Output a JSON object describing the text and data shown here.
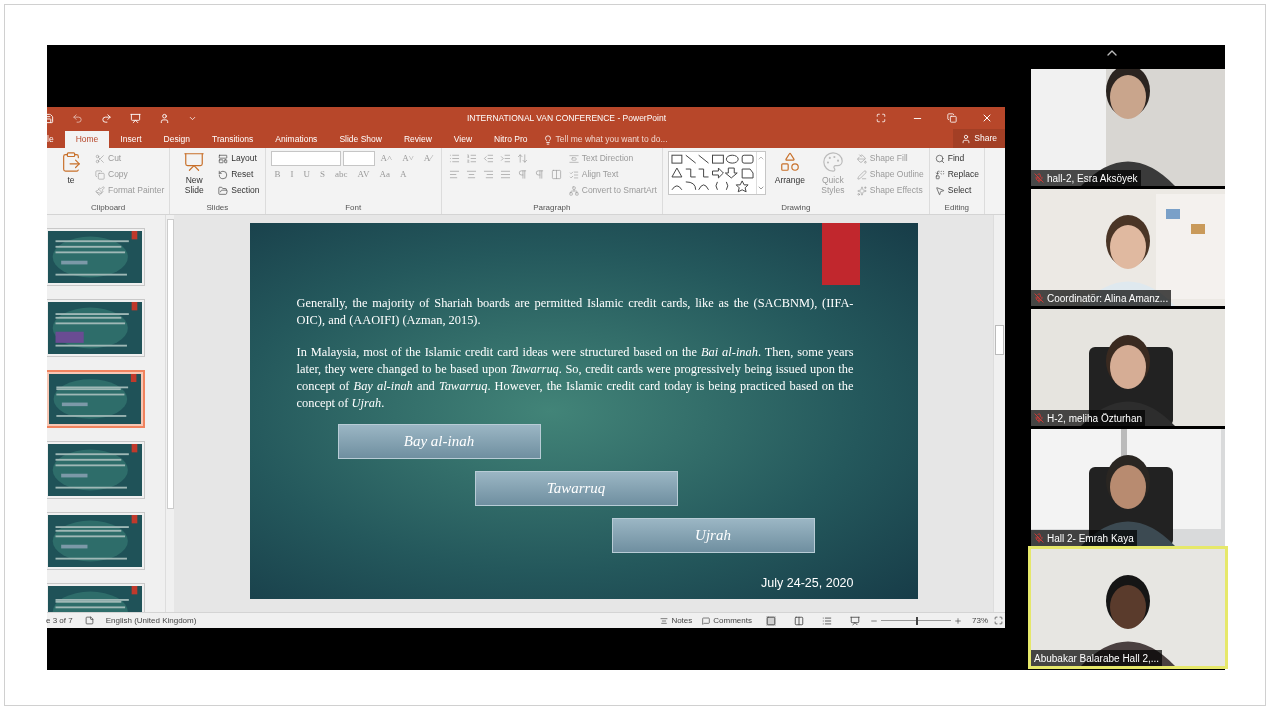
{
  "powerpoint": {
    "window": {
      "title": "INTERNATIONAL VAN CONFERENCE - PowerPoint"
    },
    "tabs": [
      {
        "label": "le",
        "selected": false
      },
      {
        "label": "Home",
        "selected": true
      },
      {
        "label": "Insert",
        "selected": false
      },
      {
        "label": "Design",
        "selected": false
      },
      {
        "label": "Transitions",
        "selected": false
      },
      {
        "label": "Animations",
        "selected": false
      },
      {
        "label": "Slide Show",
        "selected": false
      },
      {
        "label": "Review",
        "selected": false
      },
      {
        "label": "View",
        "selected": false
      },
      {
        "label": "Nitro Pro",
        "selected": false
      }
    ],
    "tell_me": {
      "placeholder": "Tell me what you want to do..."
    },
    "share_button": "Share",
    "ribbon_groups": [
      {
        "name": "Clipboard",
        "columns": [
          [
            [
              {
                "kind": "large",
                "label": "te"
              }
            ]
          ],
          [
            [
              {
                "kind": "small",
                "label": "Cut",
                "disabled": true
              }
            ],
            [
              {
                "kind": "small",
                "label": "Copy",
                "disabled": true
              }
            ],
            [
              {
                "kind": "small",
                "label": "Format Painter",
                "disabled": true
              }
            ]
          ]
        ]
      },
      {
        "name": "Slides",
        "columns": [
          [
            [
              {
                "kind": "large",
                "label": "New Slide"
              }
            ]
          ],
          [
            [
              {
                "kind": "small",
                "label": "Layout"
              }
            ],
            [
              {
                "kind": "small",
                "label": "Reset"
              }
            ],
            [
              {
                "kind": "small",
                "label": "Section"
              }
            ]
          ]
        ]
      },
      {
        "name": "Font",
        "columns": [
          [
            [
              {
                "kind": "combo"
              },
              {
                "kind": "combo-small"
              },
              {
                "kind": "glyph",
                "label": "A˄"
              },
              {
                "kind": "glyph",
                "label": "A˅"
              },
              {
                "kind": "glyph",
                "label": "A⁄"
              }
            ],
            [
              {
                "kind": "glyph",
                "label": "B"
              },
              {
                "kind": "glyph",
                "label": "I"
              },
              {
                "kind": "glyph",
                "label": "U"
              },
              {
                "kind": "glyph",
                "label": "S"
              },
              {
                "kind": "glyph",
                "label": "abc"
              },
              {
                "kind": "glyph",
                "label": "AV"
              },
              {
                "kind": "glyph",
                "label": "Aa"
              },
              {
                "kind": "glyph",
                "label": "A"
              }
            ]
          ]
        ]
      },
      {
        "name": "Paragraph",
        "columns": [
          [
            [
              {
                "kind": "icon"
              },
              {
                "kind": "icon"
              },
              {
                "kind": "icon"
              },
              {
                "kind": "icon"
              },
              {
                "kind": "icon"
              }
            ],
            [
              {
                "kind": "icon"
              },
              {
                "kind": "icon"
              },
              {
                "kind": "icon"
              },
              {
                "kind": "icon"
              },
              {
                "kind": "icon"
              },
              {
                "kind": "icon"
              },
              {
                "kind": "icon"
              }
            ]
          ],
          [
            [
              {
                "kind": "small",
                "label": "Text Direction",
                "disabled": true
              }
            ],
            [
              {
                "kind": "small",
                "label": "Align Text",
                "disabled": true
              }
            ],
            [
              {
                "kind": "small",
                "label": "Convert to SmartArt",
                "disabled": true
              }
            ]
          ]
        ]
      },
      {
        "name": "Drawing",
        "columns": [
          [
            [
              {
                "kind": "gallery"
              }
            ]
          ],
          [
            [
              {
                "kind": "large",
                "label": "Arrange"
              }
            ]
          ],
          [
            [
              {
                "kind": "large",
                "label": "Quick Styles",
                "disabled": true
              }
            ]
          ],
          [
            [
              {
                "kind": "small",
                "label": "Shape Fill",
                "disabled": true
              }
            ],
            [
              {
                "kind": "small",
                "label": "Shape Outline",
                "disabled": true
              }
            ],
            [
              {
                "kind": "small",
                "label": "Shape Effects",
                "disabled": true
              }
            ]
          ]
        ]
      },
      {
        "name": "Editing",
        "columns": [
          [
            [
              {
                "kind": "small",
                "label": "Find"
              }
            ],
            [
              {
                "kind": "small",
                "label": "Replace"
              }
            ],
            [
              {
                "kind": "small",
                "label": "Select"
              }
            ]
          ]
        ]
      }
    ],
    "slide_thumbnails": [
      {
        "selected": false
      },
      {
        "selected": false
      },
      {
        "selected": true
      },
      {
        "selected": false
      },
      {
        "selected": false
      },
      {
        "selected": false
      }
    ],
    "slide": {
      "paragraphs": [
        "Generally, the majority of Shariah boards are permitted Islamic credit cards, like as the (SACBNM), (IIFA-OIC), and (AAOIFI) (Azman, 2015).",
        "In Malaysia, most of the Islamic credit card ideas were structured based on the *Bai al-inah*. Then, some years later, they were changed to be based upon *Tawarruq*. So, credit cards were progressively being issued upon the concept of *Bay al-inah* and *Tawarruq*. However, the Islamic credit card today is being practiced based on the concept of *Ujrah*."
      ],
      "boxes": [
        "Bay al-inah",
        "Tawarruq",
        "Ujrah"
      ],
      "date": "July 24-25, 2020"
    },
    "status_bar": {
      "slide_count": "e 3 of 7",
      "language": "English (United Kingdom)",
      "notes": "Notes",
      "comments": "Comments",
      "zoom": {
        "level": 0.5,
        "reading": "73%"
      }
    }
  },
  "participants": [
    {
      "name": "hall-2, Esra Aksöyek",
      "muted": true,
      "selected": false
    },
    {
      "name": "Coordinatör: Alina Amanz...",
      "muted": true,
      "selected": false
    },
    {
      "name": "H-2, meliha Özturhan",
      "muted": true,
      "selected": false
    },
    {
      "name": "Hall 2- Emrah Kaya",
      "muted": true,
      "selected": false
    },
    {
      "name": "Abubakar Balarabe Hall 2,...",
      "muted": false,
      "selected": true
    }
  ]
}
